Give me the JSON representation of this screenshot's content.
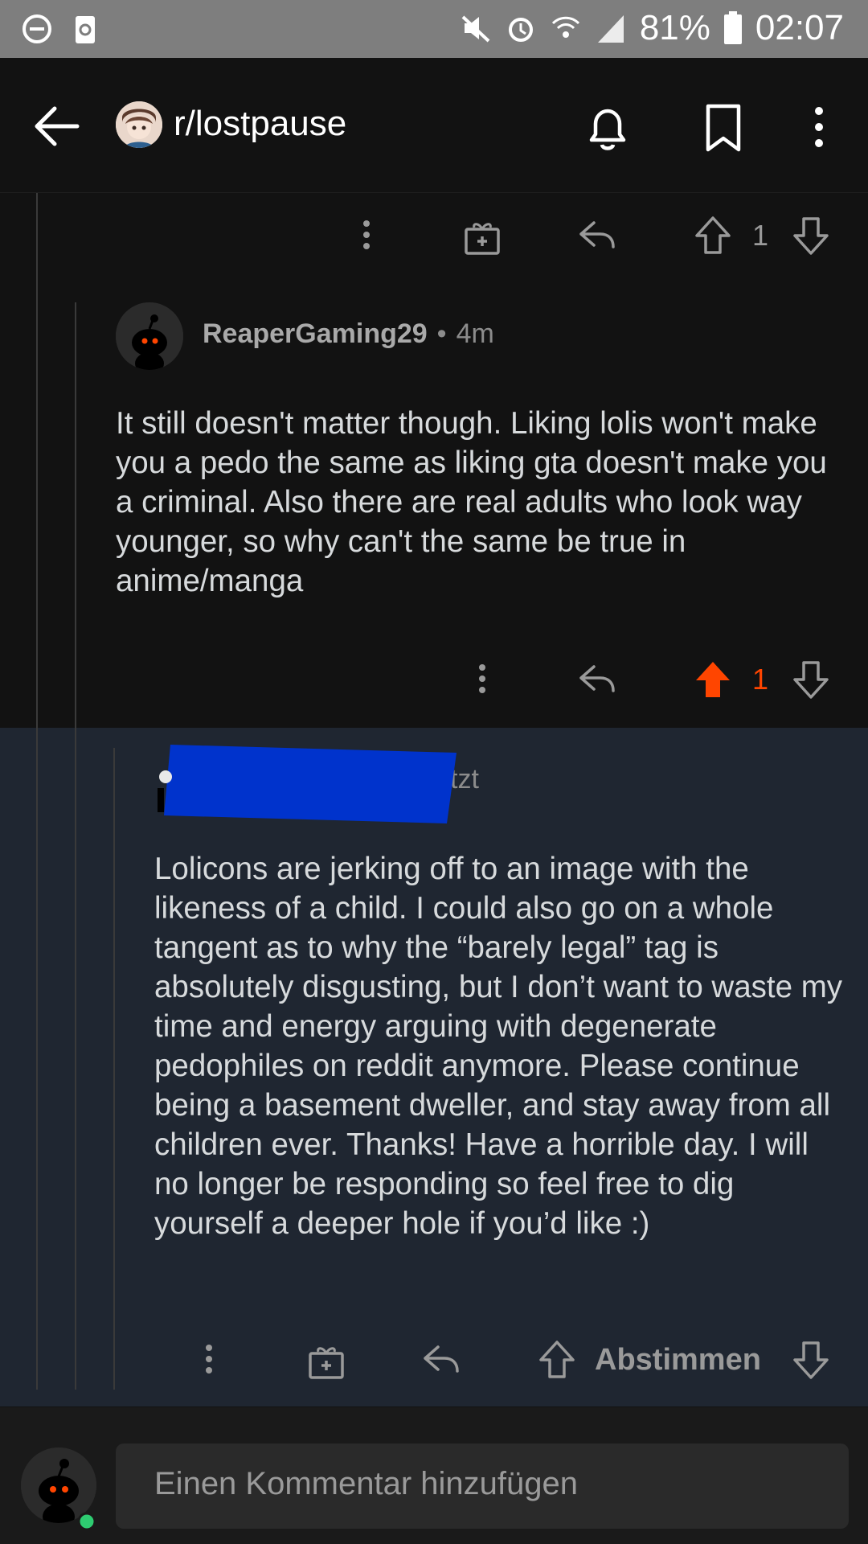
{
  "status_bar": {
    "battery": "81%",
    "time": "02:07"
  },
  "header": {
    "subreddit": "r/lostpause"
  },
  "top_actions": {
    "vote_count": "1"
  },
  "comment_1": {
    "author": "ReaperGaming29",
    "separator": "•",
    "age": "4m",
    "body": "It still doesn't matter though. Liking lolis won't make you a pedo the same as liking gta doesn't make you a criminal. Also there are real adults who look way younger, so why can't the same be true in anime/manga",
    "vote_count": "1"
  },
  "comment_2": {
    "meta_visible": "tzt",
    "body": "Lolicons are jerking off to an image with the likeness of a child. I could also go on a whole tangent as to why the “barely legal” tag is absolutely disgusting, but I don’t want to waste my time and energy arguing with degenerate pedophiles on reddit anymore. Please continue being a basement dweller, and stay away from all children ever. Thanks! Have a horrible day. I will no longer be responding so feel free to dig yourself a deeper hole if you’d like :)",
    "vote_label": "Abstimmen"
  },
  "composer": {
    "placeholder": "Einen Kommentar hinzufügen"
  },
  "colors": {
    "upvote_active": "#ff4500",
    "highlight_bg": "#1f2631",
    "redaction": "#0033cc",
    "online_dot": "#2ecc71"
  }
}
